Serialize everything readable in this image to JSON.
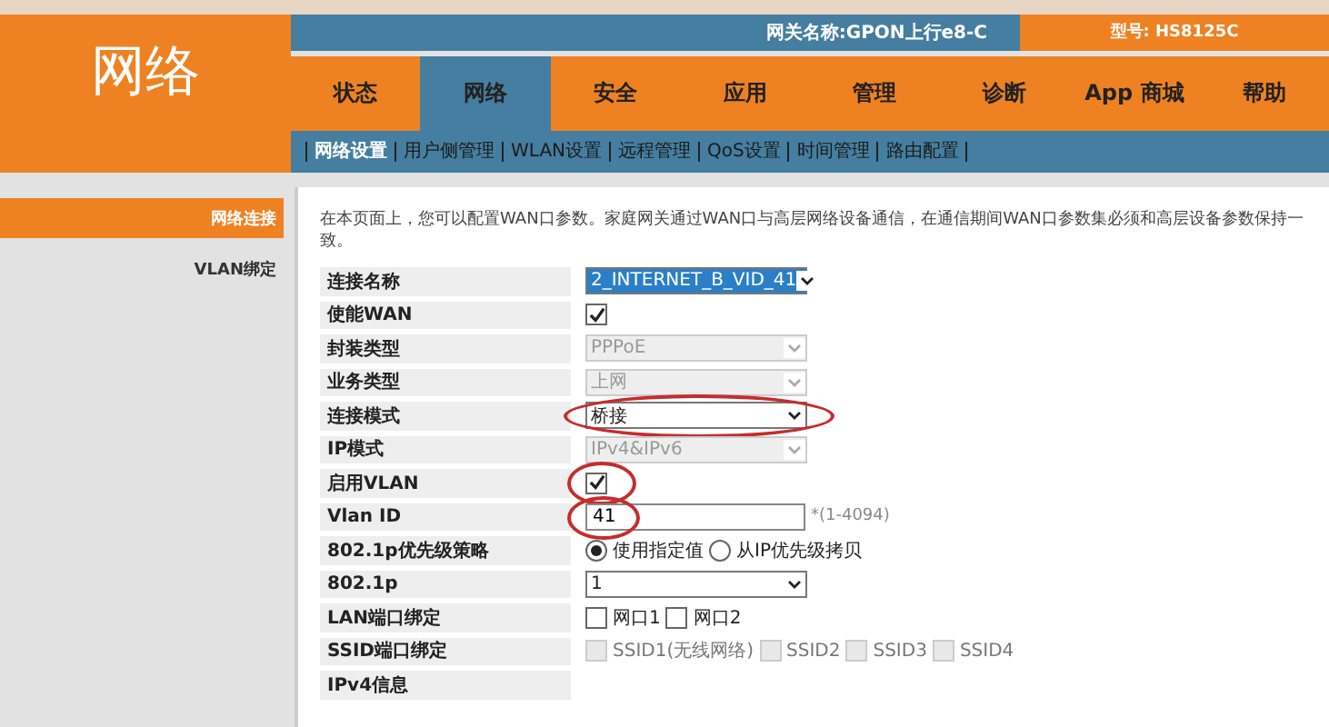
{
  "header": {
    "section_title": "网络",
    "gateway_name": "网关名称:GPON上行e8-C",
    "model": "型号: HS8125C"
  },
  "nav": [
    {
      "label": "状态",
      "selected": false
    },
    {
      "label": "网络",
      "selected": true
    },
    {
      "label": "安全",
      "selected": false
    },
    {
      "label": "应用",
      "selected": false
    },
    {
      "label": "管理",
      "selected": false
    },
    {
      "label": "诊断",
      "selected": false
    },
    {
      "label": "App 商城",
      "selected": false
    },
    {
      "label": "帮助",
      "selected": false
    }
  ],
  "subnav": [
    {
      "label": "网络设置",
      "selected": true
    },
    {
      "label": "用户侧管理",
      "selected": false
    },
    {
      "label": "WLAN设置",
      "selected": false
    },
    {
      "label": "远程管理",
      "selected": false
    },
    {
      "label": "QoS设置",
      "selected": false
    },
    {
      "label": "时间管理",
      "selected": false
    },
    {
      "label": "路由配置",
      "selected": false
    }
  ],
  "sidebar": [
    {
      "label": "网络连接",
      "selected": true
    },
    {
      "label": "VLAN绑定",
      "selected": false
    }
  ],
  "intro": "在本页面上，您可以配置WAN口参数。家庭网关通过WAN口与高层网络设备通信，在通信期间WAN口参数集必须和高层设备参数保持一致。",
  "form": [
    {
      "kind": "select",
      "label": "连接名称",
      "value": "2_INTERNET_B_VID_41",
      "highlighted": true,
      "disabled": false,
      "circled": false
    },
    {
      "kind": "checkbox",
      "label": "使能WAN",
      "checked": true,
      "circled": false
    },
    {
      "kind": "select",
      "label": "封装类型",
      "value": "PPPoE",
      "highlighted": false,
      "disabled": true,
      "circled": false
    },
    {
      "kind": "select",
      "label": "业务类型",
      "value": "上网",
      "highlighted": false,
      "disabled": true,
      "circled": false
    },
    {
      "kind": "select",
      "label": "连接模式",
      "value": "桥接",
      "highlighted": false,
      "disabled": false,
      "circled": true
    },
    {
      "kind": "select",
      "label": "IP模式",
      "value": "IPv4&IPv6",
      "highlighted": false,
      "disabled": true,
      "circled": false
    },
    {
      "kind": "checkbox",
      "label": "启用VLAN",
      "checked": true,
      "circled": true
    },
    {
      "kind": "text",
      "label": "Vlan ID",
      "value": "41",
      "hint": "*(1-4094)",
      "circled": true
    },
    {
      "kind": "radio",
      "label": "802.1p优先级策略",
      "options": [
        {
          "label": "使用指定值",
          "selected": true
        },
        {
          "label": "从IP优先级拷贝",
          "selected": false
        }
      ]
    },
    {
      "kind": "select",
      "label": "802.1p",
      "value": "1",
      "highlighted": false,
      "disabled": false,
      "circled": false
    },
    {
      "kind": "checks",
      "label": "LAN端口绑定",
      "disabled": false,
      "options": [
        {
          "label": "网口1",
          "checked": false
        },
        {
          "label": "网口2",
          "checked": false
        }
      ]
    },
    {
      "kind": "checks",
      "label": "SSID端口绑定",
      "disabled": true,
      "options": [
        {
          "label": "SSID1(无线网络)",
          "checked": false
        },
        {
          "label": "SSID2",
          "checked": false
        },
        {
          "label": "SSID3",
          "checked": false
        },
        {
          "label": "SSID4",
          "checked": false
        }
      ]
    },
    {
      "kind": "heading",
      "label": "IPv4信息"
    }
  ]
}
